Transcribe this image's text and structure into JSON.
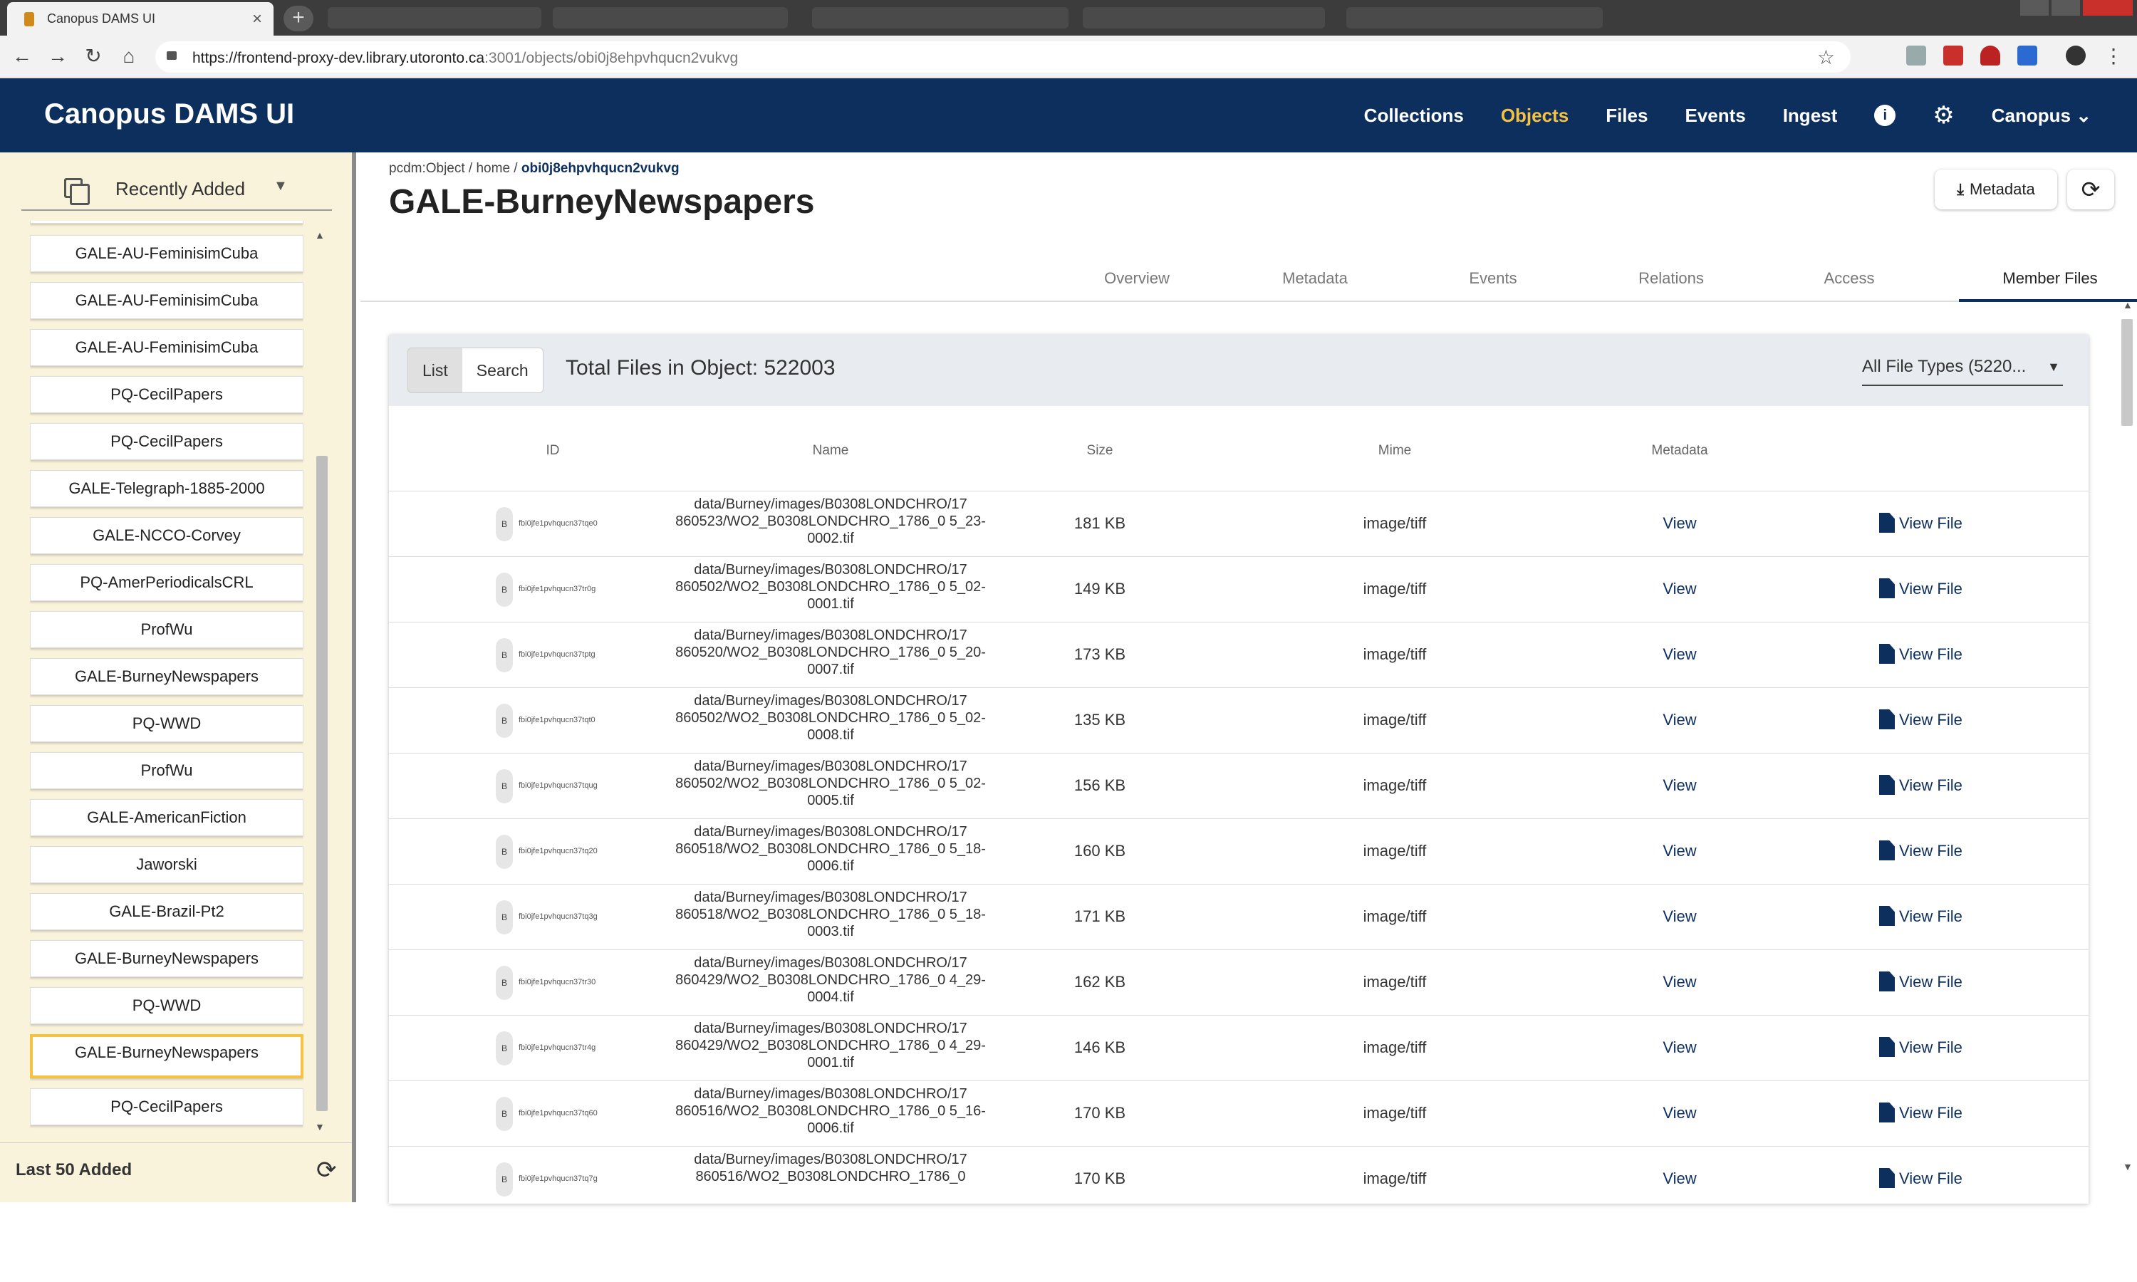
{
  "browser": {
    "tab_title": "Canopus DAMS UI",
    "tab_close": "×",
    "new_tab": "+",
    "url_host": "https://frontend-proxy-dev.library.utoronto.ca",
    "url_rest": ":3001/objects/obi0j8ehpvhqucn2vukvg",
    "nav_back": "←",
    "nav_forward": "→",
    "nav_reload": "↻",
    "nav_home": "⌂",
    "bookmark": "☆"
  },
  "app": {
    "brand": "Canopus DAMS UI",
    "nav": {
      "collections": "Collections",
      "objects": "Objects",
      "files": "Files",
      "events": "Events",
      "ingest": "Ingest",
      "info": "i",
      "settings": "⚙",
      "user": "Canopus ⌄"
    }
  },
  "sidebar": {
    "title": "Recently Added",
    "caret": "▼",
    "items": [
      "GALE-AU-FeminisimCuba",
      "GALE-AU-FeminisimCuba",
      "GALE-AU-FeminisimCuba",
      "PQ-CecilPapers",
      "PQ-CecilPapers",
      "GALE-Telegraph-1885-2000",
      "GALE-NCCO-Corvey",
      "PQ-AmerPeriodicalsCRL",
      "ProfWu",
      "GALE-BurneyNewspapers",
      "PQ-WWD",
      "ProfWu",
      "GALE-AmericanFiction",
      "Jaworski",
      "GALE-Brazil-Pt2",
      "GALE-BurneyNewspapers",
      "PQ-WWD",
      "GALE-BurneyNewspapers",
      "PQ-CecilPapers"
    ],
    "footer_label": "Last 50 Added",
    "footer_refresh": "⟳",
    "scroll_up": "▲",
    "scroll_down": "▼"
  },
  "page": {
    "breadcrumb_prefix": "pcdm:Object / home / ",
    "breadcrumb_current": "obi0j8ehpvhqucn2vukvg",
    "title": "GALE-BurneyNewspapers",
    "metadata_button": "Metadata",
    "download_icon": "⤓",
    "refresh_icon": "⟳",
    "tabs": [
      "Overview",
      "Metadata",
      "Events",
      "Relations",
      "Access",
      "Member Files"
    ]
  },
  "files": {
    "list_label": "List",
    "search_label": "Search",
    "total": "Total Files in Object: 522003",
    "filetype_filter": "All File Types (5220...",
    "filetype_caret": "▼",
    "columns": [
      "ID",
      "Name",
      "Size",
      "Mime",
      "Metadata"
    ],
    "badge": "B",
    "rows": [
      {
        "id": "fbi0jfe1pvhqucn37tqe0",
        "name": "data/Burney/images/B0308LONDCHRO/17 860523/WO2_B0308LONDCHRO_1786_0 5_23-0002.tif",
        "size": "181 KB",
        "mime": "image/tiff",
        "meta": "View",
        "action": "View File"
      },
      {
        "id": "fbi0jfe1pvhqucn37tr0g",
        "name": "data/Burney/images/B0308LONDCHRO/17 860502/WO2_B0308LONDCHRO_1786_0 5_02-0001.tif",
        "size": "149 KB",
        "mime": "image/tiff",
        "meta": "View",
        "action": "View File"
      },
      {
        "id": "fbi0jfe1pvhqucn37tptg",
        "name": "data/Burney/images/B0308LONDCHRO/17 860520/WO2_B0308LONDCHRO_1786_0 5_20-0007.tif",
        "size": "173 KB",
        "mime": "image/tiff",
        "meta": "View",
        "action": "View File"
      },
      {
        "id": "fbi0jfe1pvhqucn37tqt0",
        "name": "data/Burney/images/B0308LONDCHRO/17 860502/WO2_B0308LONDCHRO_1786_0 5_02-0008.tif",
        "size": "135 KB",
        "mime": "image/tiff",
        "meta": "View",
        "action": "View File"
      },
      {
        "id": "fbi0jfe1pvhqucn37tqug",
        "name": "data/Burney/images/B0308LONDCHRO/17 860502/WO2_B0308LONDCHRO_1786_0 5_02-0005.tif",
        "size": "156 KB",
        "mime": "image/tiff",
        "meta": "View",
        "action": "View File"
      },
      {
        "id": "fbi0jfe1pvhqucn37tq20",
        "name": "data/Burney/images/B0308LONDCHRO/17 860518/WO2_B0308LONDCHRO_1786_0 5_18-0006.tif",
        "size": "160 KB",
        "mime": "image/tiff",
        "meta": "View",
        "action": "View File"
      },
      {
        "id": "fbi0jfe1pvhqucn37tq3g",
        "name": "data/Burney/images/B0308LONDCHRO/17 860518/WO2_B0308LONDCHRO_1786_0 5_18-0003.tif",
        "size": "171 KB",
        "mime": "image/tiff",
        "meta": "View",
        "action": "View File"
      },
      {
        "id": "fbi0jfe1pvhqucn37tr30",
        "name": "data/Burney/images/B0308LONDCHRO/17 860429/WO2_B0308LONDCHRO_1786_0 4_29-0004.tif",
        "size": "162 KB",
        "mime": "image/tiff",
        "meta": "View",
        "action": "View File"
      },
      {
        "id": "fbi0jfe1pvhqucn37tr4g",
        "name": "data/Burney/images/B0308LONDCHRO/17 860429/WO2_B0308LONDCHRO_1786_0 4_29-0001.tif",
        "size": "146 KB",
        "mime": "image/tiff",
        "meta": "View",
        "action": "View File"
      },
      {
        "id": "fbi0jfe1pvhqucn37tq60",
        "name": "data/Burney/images/B0308LONDCHRO/17 860516/WO2_B0308LONDCHRO_1786_0 5_16-0006.tif",
        "size": "170 KB",
        "mime": "image/tiff",
        "meta": "View",
        "action": "View File"
      },
      {
        "id": "fbi0jfe1pvhqucn37tq7g",
        "name": "data/Burney/images/B0308LONDCHRO/17 860516/WO2_B0308LONDCHRO_1786_0",
        "size": "170 KB",
        "mime": "image/tiff",
        "meta": "View",
        "action": "View File"
      }
    ]
  }
}
